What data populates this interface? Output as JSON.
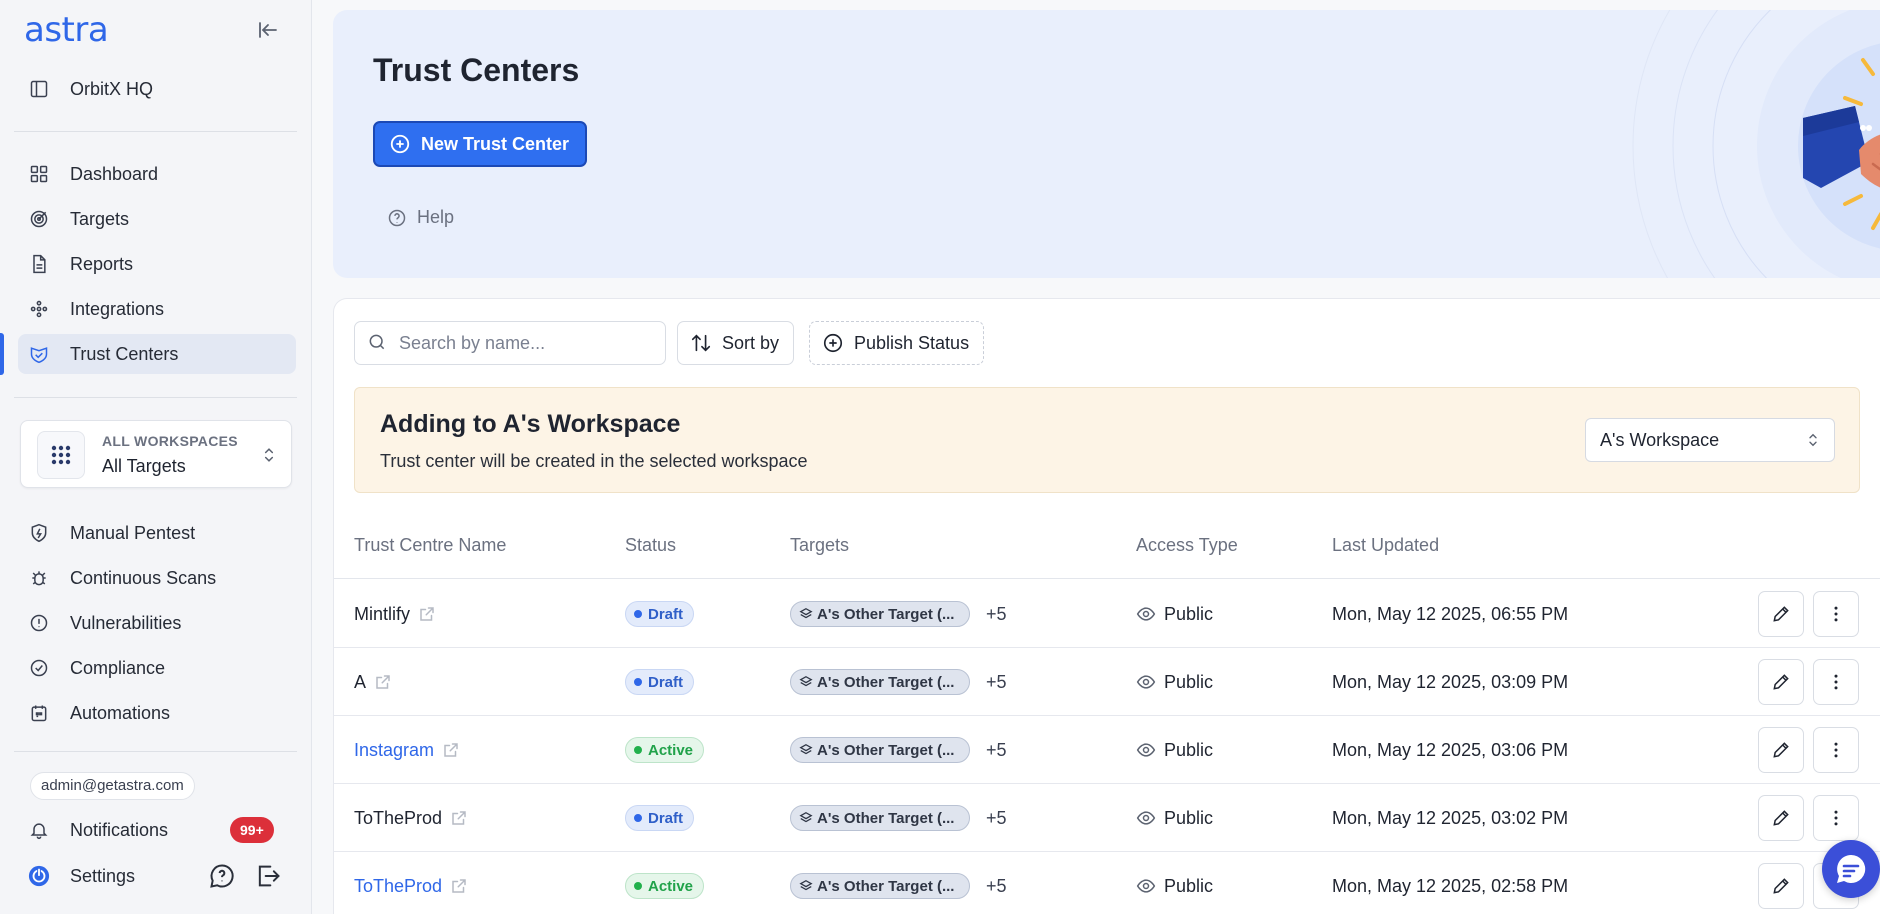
{
  "sidebar": {
    "logo": "astra",
    "org": "OrbitX HQ",
    "nav": [
      {
        "label": "Dashboard",
        "icon": "grid-icon"
      },
      {
        "label": "Targets",
        "icon": "target-icon"
      },
      {
        "label": "Reports",
        "icon": "document-icon"
      },
      {
        "label": "Integrations",
        "icon": "integrations-icon"
      },
      {
        "label": "Trust Centers",
        "icon": "handshake-icon",
        "active": true
      }
    ],
    "workspace": {
      "caption": "ALL WORKSPACES",
      "value": "All Targets"
    },
    "nav2": [
      {
        "label": "Manual Pentest",
        "icon": "shield-icon"
      },
      {
        "label": "Continuous Scans",
        "icon": "bug-icon"
      },
      {
        "label": "Vulnerabilities",
        "icon": "alert-icon"
      },
      {
        "label": "Compliance",
        "icon": "check-circle-icon"
      },
      {
        "label": "Automations",
        "icon": "calendar-icon"
      }
    ],
    "email": "admin@getastra.com",
    "notifications": {
      "label": "Notifications",
      "count": "99+"
    },
    "settings": {
      "label": "Settings"
    }
  },
  "header": {
    "title": "Trust Centers",
    "new_button": "New Trust Center",
    "help": "Help"
  },
  "toolbar": {
    "search_placeholder": "Search by name...",
    "sort_label": "Sort by",
    "publish_label": "Publish Status"
  },
  "notice": {
    "title": "Adding to A's Workspace",
    "text": "Trust center will be created in the selected workspace",
    "select_value": "A's Workspace"
  },
  "table": {
    "columns": [
      "Trust Centre Name",
      "Status",
      "Targets",
      "Access Type",
      "Last Updated"
    ],
    "rows": [
      {
        "name": "Mintlify",
        "link": false,
        "status": "Draft",
        "target": "A's Other Target (...",
        "more": "+5",
        "access": "Public",
        "updated": "Mon, May 12 2025, 06:55 PM"
      },
      {
        "name": "A",
        "link": false,
        "status": "Draft",
        "target": "A's Other Target (...",
        "more": "+5",
        "access": "Public",
        "updated": "Mon, May 12 2025, 03:09 PM"
      },
      {
        "name": "Instagram",
        "link": true,
        "status": "Active",
        "target": "A's Other Target (...",
        "more": "+5",
        "access": "Public",
        "updated": "Mon, May 12 2025, 03:06 PM"
      },
      {
        "name": "ToTheProd",
        "link": false,
        "status": "Draft",
        "target": "A's Other Target (...",
        "more": "+5",
        "access": "Public",
        "updated": "Mon, May 12 2025, 03:02 PM"
      },
      {
        "name": "ToTheProd",
        "link": true,
        "status": "Active",
        "target": "A's Other Target (...",
        "more": "+5",
        "access": "Public",
        "updated": "Mon, May 12 2025, 02:58 PM"
      }
    ]
  },
  "colors": {
    "accent": "#2f67e8",
    "draft": "#2f67e8",
    "active": "#22b04c",
    "badge": "#dc2f3a"
  }
}
